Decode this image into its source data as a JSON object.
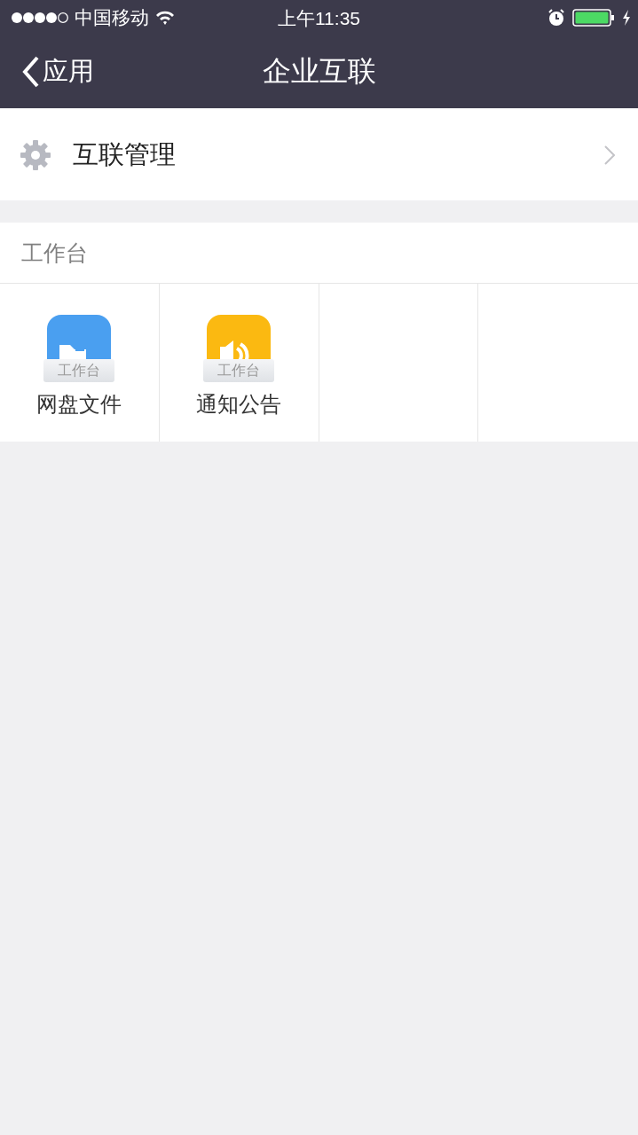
{
  "status_bar": {
    "carrier": "中国移动",
    "time": "上午11:35"
  },
  "nav_bar": {
    "back": "应用",
    "title": "企业互联"
  },
  "settings_row": {
    "label": "互联管理"
  },
  "section": {
    "title": "工作台"
  },
  "apps": [
    {
      "kind": "folder",
      "color": "#4a9ff0",
      "badge": "工作台",
      "label": "网盘文件"
    },
    {
      "kind": "speaker",
      "color": "#fbb911",
      "badge": "工作台",
      "label": "通知公告"
    }
  ]
}
